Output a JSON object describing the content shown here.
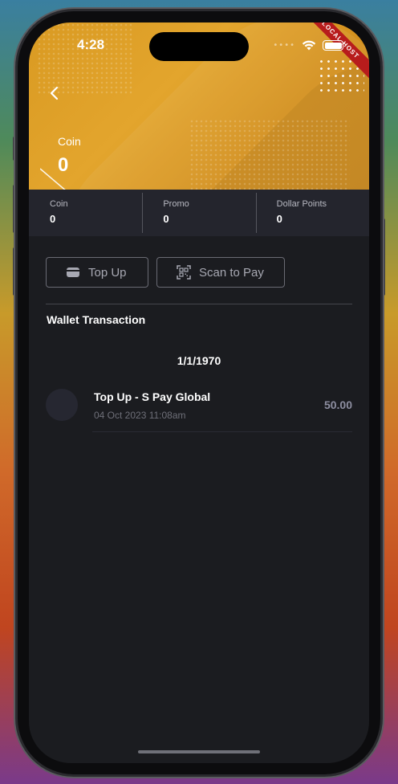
{
  "status_bar": {
    "time": "4:28",
    "signal_icon": "cellular-dots-icon",
    "wifi_icon": "wifi-icon",
    "battery_icon": "battery-icon"
  },
  "environment_ribbon": "LOCAL HOST",
  "header": {
    "back_icon": "chevron-left-icon",
    "balance_label": "Coin",
    "balance_value": "0"
  },
  "stats": [
    {
      "label": "Coin",
      "value": "0"
    },
    {
      "label": "Promo",
      "value": "0"
    },
    {
      "label": "Dollar Points",
      "value": "0"
    }
  ],
  "actions": {
    "topup_label": "Top Up",
    "topup_icon": "wallet-icon",
    "scan_label": "Scan to Pay",
    "scan_icon": "qr-scan-icon"
  },
  "wallet": {
    "section_title": "Wallet Transaction",
    "groups": [
      {
        "date": "1/1/1970",
        "transactions": [
          {
            "title": "Top Up - S Pay Global",
            "datetime": "04 Oct 2023 11:08am",
            "amount": "50.00"
          }
        ]
      }
    ]
  },
  "colors": {
    "header_gold": "#e3a52d",
    "background": "#1b1c20",
    "stats_bar": "#24252d",
    "ribbon_red": "#b71c1c"
  }
}
